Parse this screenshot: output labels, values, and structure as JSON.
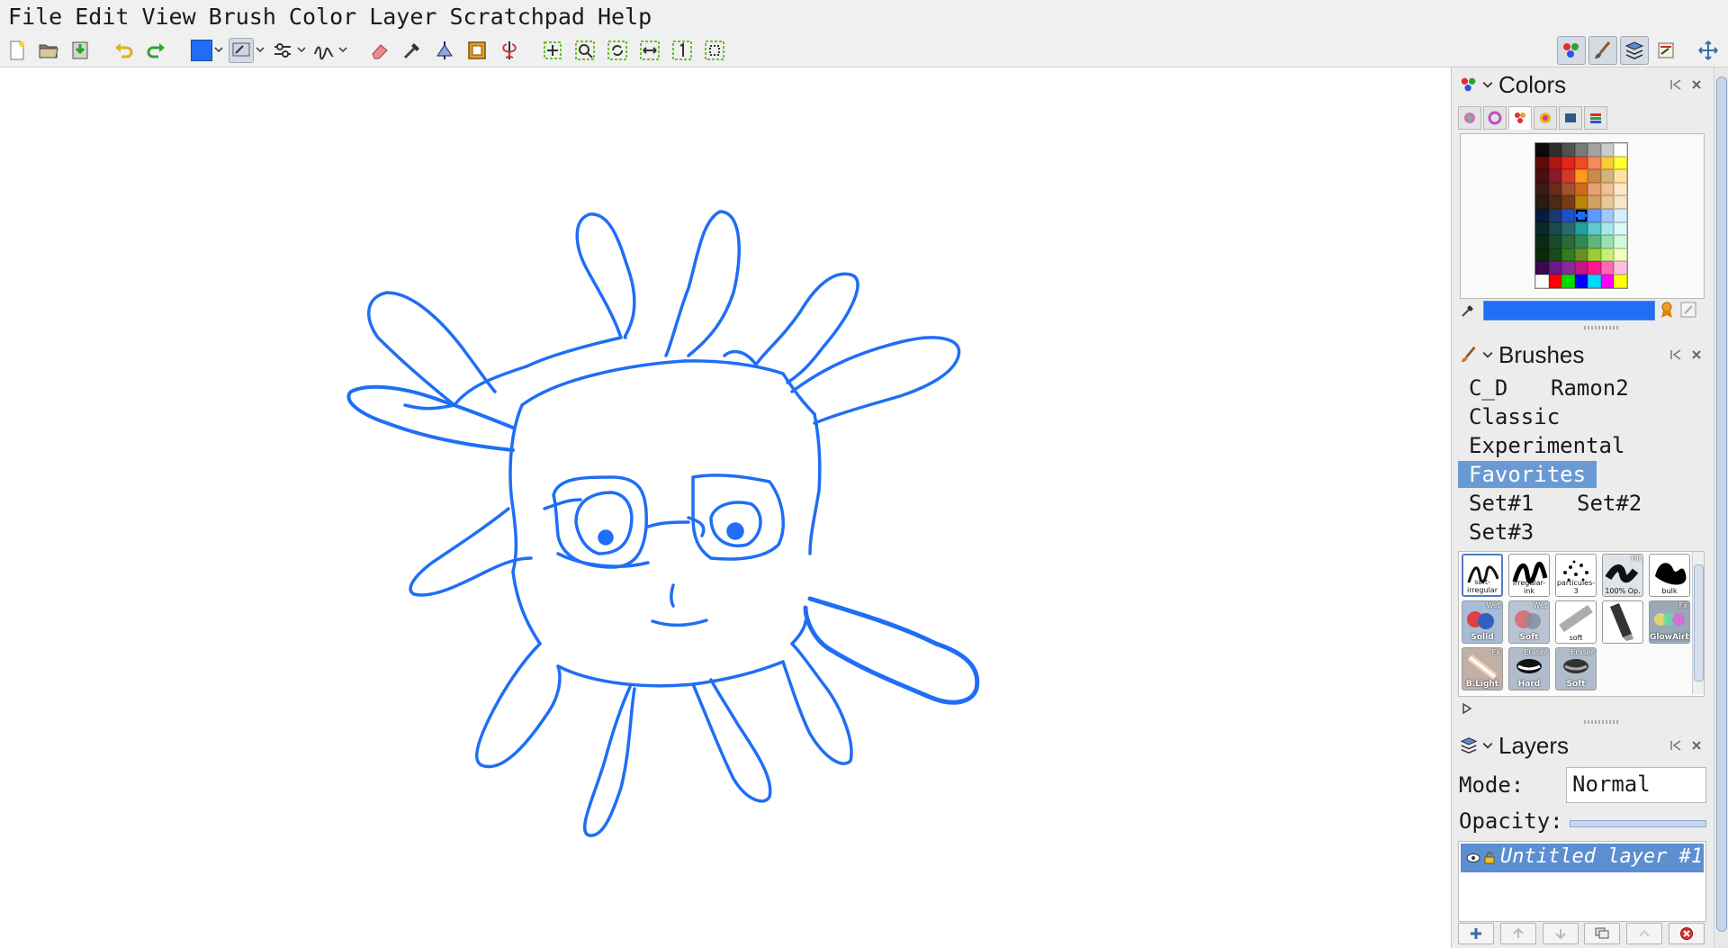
{
  "menubar": {
    "items": [
      "File",
      "Edit",
      "View",
      "Brush",
      "Color",
      "Layer",
      "Scratchpad",
      "Help"
    ]
  },
  "toolbar": {
    "icons": [
      "new-document-icon",
      "open-file-icon",
      "save-file-icon",
      "undo-icon",
      "redo-icon",
      "color-swatch",
      "brush-settings-icon",
      "adjust-icon",
      "stroke-icon",
      "eraser-icon",
      "color-picker-icon",
      "symmetry-icon",
      "frame-icon",
      "mirror-icon",
      "pan-icon",
      "zoom-icon",
      "rotate-icon",
      "flip-icon",
      "one-to-one-icon",
      "fit-icon"
    ],
    "current_color": "#1f6ef5"
  },
  "colors_panel": {
    "title": "Colors",
    "selected_color": "#1f6ef5",
    "palette": [
      "#0a0a0a",
      "#2d2d2d",
      "#515151",
      "#7a7a7a",
      "#a3a3a3",
      "#cccccc",
      "#ffffff",
      "#5c0b0b",
      "#b31515",
      "#e5241c",
      "#f04a1f",
      "#f38c5a",
      "#ffcc33",
      "#ffff33",
      "#4a1010",
      "#8a1b2a",
      "#d23a2a",
      "#ff9a1f",
      "#c98a4a",
      "#d2b47a",
      "#ffe0a0",
      "#3a1a1a",
      "#6b2a1a",
      "#a0522d",
      "#d2691e",
      "#e8a070",
      "#f0c090",
      "#ffe8c8",
      "#2a1a10",
      "#4a2a18",
      "#7a3a18",
      "#b8860b",
      "#d2a060",
      "#e8c898",
      "#f5e6cc",
      "#0a1a3a",
      "#1a3a6a",
      "#1f4fc8",
      "#1f6ef5",
      "#5b9bff",
      "#9ec8ff",
      "#d8ecff",
      "#0a2a2a",
      "#1a4a4a",
      "#2a6a6a",
      "#20a0a0",
      "#60c8c8",
      "#a8e8e8",
      "#dcf8f8",
      "#0a2a1a",
      "#1a4a2a",
      "#2a6a3a",
      "#2e8b57",
      "#5cb87a",
      "#98e0b0",
      "#d4f8dc",
      "#0a2a0a",
      "#1a4a1a",
      "#2e7d1e",
      "#6b8e23",
      "#9acd32",
      "#c8f078",
      "#f0ffc0",
      "#3a0a4a",
      "#6a1a8a",
      "#8a2a9a",
      "#c71585",
      "#ff1493",
      "#ff69b4",
      "#ffc0e0",
      "#ffffff",
      "#ff0000",
      "#00e000",
      "#0000ff",
      "#00d8ff",
      "#ff00ff",
      "#ffff00"
    ]
  },
  "brushes_panel": {
    "title": "Brushes",
    "groups": [
      "C_D",
      "Ramon2",
      "Classic",
      "Experimental",
      "Favorites",
      "Set#1",
      "Set#2",
      "Set#3"
    ],
    "active_group": "Favorites",
    "brushes": [
      {
        "label": "soft-irregular",
        "tag": ""
      },
      {
        "label": "irregular-ink",
        "tag": ""
      },
      {
        "label": "particules-3",
        "tag": ""
      },
      {
        "label": "100% Op.",
        "tag": "Fill"
      },
      {
        "label": "bulk",
        "tag": ""
      },
      {
        "label": "Solid",
        "tag": "Wet"
      },
      {
        "label": "Soft",
        "tag": "Wet"
      },
      {
        "label": "soft",
        "tag": ""
      },
      {
        "label": "",
        "tag": ""
      },
      {
        "label": "GlowAirb",
        "tag": "Fx"
      },
      {
        "label": "B.Light",
        "tag": "Fx"
      },
      {
        "label": "Hard",
        "tag": "Eraser"
      },
      {
        "label": "Soft",
        "tag": "Eraser"
      }
    ]
  },
  "layers_panel": {
    "title": "Layers",
    "mode_label": "Mode:",
    "mode_value": "Normal",
    "opacity_label": "Opacity:",
    "opacity": 1.0,
    "layers": [
      "Untitled layer #1"
    ]
  }
}
